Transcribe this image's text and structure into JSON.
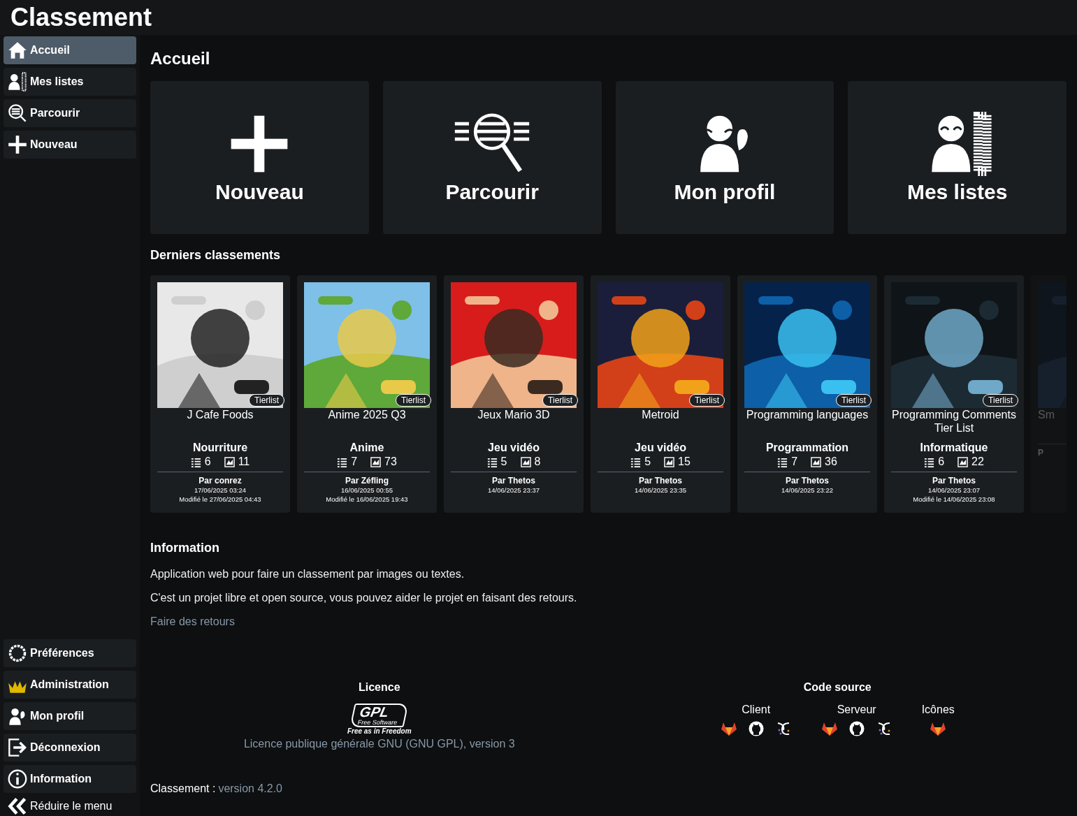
{
  "app_title": "Classement",
  "sidebar": {
    "top_items": [
      {
        "label": "Accueil",
        "kind": "home",
        "selected": true
      },
      {
        "label": "Mes listes",
        "kind": "lists",
        "selected": false
      },
      {
        "label": "Parcourir",
        "kind": "browse",
        "selected": false
      },
      {
        "label": "Nouveau",
        "kind": "plus",
        "selected": false
      }
    ],
    "bottom_items": [
      {
        "label": "Préférences",
        "kind": "gear",
        "selected": false
      },
      {
        "label": "Administration",
        "kind": "crown",
        "selected": false
      },
      {
        "label": "Mon profil",
        "kind": "profile",
        "selected": false
      },
      {
        "label": "Déconnexion",
        "kind": "logout",
        "selected": false
      },
      {
        "label": "Information",
        "kind": "info",
        "selected": false
      }
    ],
    "collapse": "Réduire le menu"
  },
  "page_title": "Accueil",
  "tiles": [
    {
      "label": "Nouveau",
      "kind": "plus"
    },
    {
      "label": "Parcourir",
      "kind": "browse"
    },
    {
      "label": "Mon profil",
      "kind": "profile"
    },
    {
      "label": "Mes listes",
      "kind": "lists"
    }
  ],
  "recent": {
    "heading": "Derniers classements",
    "cards": [
      {
        "title": "J Cafe Foods",
        "badge": "Tierlist",
        "category": "Nourriture",
        "lists": "6",
        "items": "11",
        "author": "Par conrez",
        "created": "17/06/2025 03:24",
        "modified": "Modifié le 27/06/2025 04:43",
        "partial": false
      },
      {
        "title": "Anime 2025 Q3",
        "badge": "Tierlist",
        "category": "Anime",
        "lists": "7",
        "items": "73",
        "author": "Par Zéfling",
        "created": "16/06/2025 00:55",
        "modified": "Modifié le 16/06/2025 19:43",
        "partial": false
      },
      {
        "title": "Jeux Mario 3D",
        "badge": "Tierlist",
        "category": "Jeu vidéo",
        "lists": "5",
        "items": "8",
        "author": "Par Thetos",
        "created": "14/06/2025 23:37",
        "partial": false
      },
      {
        "title": "Metroid",
        "badge": "Tierlist",
        "category": "Jeu vidéo",
        "lists": "5",
        "items": "15",
        "author": "Par Thetos",
        "created": "14/06/2025 23:35",
        "partial": false
      },
      {
        "title": "Programming languages",
        "badge": "Tierlist",
        "category": "Programmation",
        "lists": "7",
        "items": "36",
        "author": "Par Thetos",
        "created": "14/06/2025 23:22",
        "partial": false
      },
      {
        "title": "Programming Comments Tier List",
        "badge": "Tierlist",
        "category": "Informatique",
        "lists": "6",
        "items": "22",
        "author": "Par Thetos",
        "created": "14/06/2025 23:07",
        "modified": "Modifié le 14/06/2025 23:08",
        "partial": false
      },
      {
        "title": "Sm",
        "author": "P",
        "partial": true
      }
    ]
  },
  "info": {
    "heading": "Information",
    "paragraphs": [
      "Application web pour faire un classement par images ou textes.",
      "C'est un projet libre et open source, vous pouvez aider le projet en faisant des retours."
    ],
    "link": "Faire des retours"
  },
  "footer": {
    "licence": {
      "heading": "Licence",
      "logo_text": "GPL",
      "logo_sub": "Free Software",
      "logo_tagline": "Free as in Freedom",
      "link": "Licence publique générale GNU (GNU GPL), version 3"
    },
    "source": {
      "heading": "Code source",
      "groups": [
        {
          "label": "Client",
          "links": [
            {
              "kind": "fox"
            },
            {
              "kind": "cat"
            },
            {
              "kind": "swirl"
            }
          ]
        },
        {
          "label": "Serveur",
          "links": [
            {
              "kind": "fox"
            },
            {
              "kind": "cat"
            },
            {
              "kind": "swirl"
            }
          ]
        },
        {
          "label": "Icônes",
          "links": [
            {
              "kind": "fox"
            }
          ]
        }
      ]
    }
  },
  "version": {
    "label": "Classement :",
    "value": "version 4.2.0"
  }
}
